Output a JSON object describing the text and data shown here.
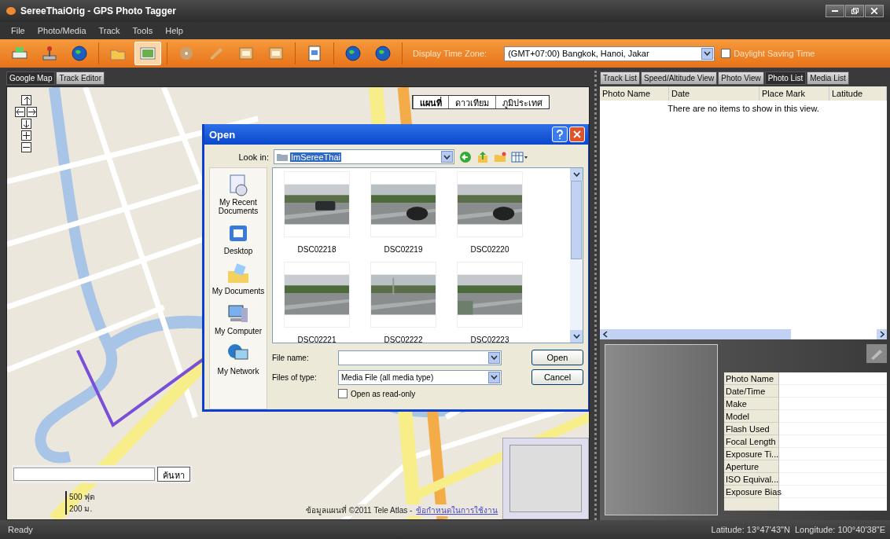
{
  "window": {
    "title": "SereeThaiOrig - GPS Photo Tagger"
  },
  "menu": [
    "File",
    "Photo/Media",
    "Track",
    "Tools",
    "Help"
  ],
  "toolbar": {
    "buttons": [
      {
        "selected": false
      },
      {
        "selected": false
      },
      {
        "selected": false
      },
      {
        "selected": false
      },
      {
        "selected": true
      },
      {
        "selected": false
      },
      {
        "selected": false
      },
      {
        "selected": false
      },
      {
        "selected": false
      },
      {
        "selected": false
      },
      {
        "selected": false
      },
      {
        "selected": false
      }
    ],
    "time_zone_label": "Display Time Zone:",
    "time_zone": "(GMT+07:00) Bangkok, Hanoi, Jakar",
    "daylight_saving": {
      "label": "Daylight Saving Time",
      "checked": false
    }
  },
  "left_tabs": [
    {
      "label": "Google Map",
      "selected": true
    },
    {
      "label": "Track Editor",
      "selected": false
    }
  ],
  "map": {
    "map_types": [
      {
        "label": "แผนที่",
        "selected": true
      },
      {
        "label": "ดาวเทียม",
        "selected": false
      },
      {
        "label": "ภูมิประเทศ",
        "selected": false
      }
    ],
    "search_button": "ค้นหา",
    "scale": [
      "500 ฟุต",
      "200 ม."
    ],
    "copyright": "ข้อมูลแผนที่ ©2011 Tele Atlas -",
    "terms_link": "ข้อกำหนดในการใช้งาน"
  },
  "dialog": {
    "title": "Open",
    "look_in_label": "Look in:",
    "look_in": "ImSereeThai",
    "places": [
      {
        "label": "My Recent Documents"
      },
      {
        "label": "Desktop"
      },
      {
        "label": "My Documents"
      },
      {
        "label": "My Computer"
      },
      {
        "label": "My Network"
      }
    ],
    "files": [
      "DSC02218",
      "DSC02219",
      "DSC02220",
      "DSC02221",
      "DSC02222",
      "DSC02223"
    ],
    "file_name_label": "File name:",
    "file_type_label": "Files of type:",
    "file_type": "Media File (all media type)",
    "read_only": {
      "label": "Open as read-only",
      "checked": false
    },
    "buttons": [
      "Open",
      "Cancel"
    ]
  },
  "right_tabs": [
    {
      "label": "Track List",
      "selected": false
    },
    {
      "label": "Speed/Altitude View",
      "selected": false
    },
    {
      "label": "Photo View",
      "selected": false
    },
    {
      "label": "Photo List",
      "selected": true
    },
    {
      "label": "Media List",
      "selected": false
    }
  ],
  "photo_list": {
    "columns": [
      "Photo Name",
      "Date",
      "Place Mark",
      "Latitude"
    ],
    "empty_message": "There are no items to show in this view."
  },
  "properties": [
    "Photo Name",
    "Date/Time",
    "Make",
    "Model",
    "Flash Used",
    "Focal Length",
    "Exposure Ti...",
    "Aperture",
    "ISO Equival...",
    "Exposure Bias"
  ],
  "status_bar": {
    "text": "Ready",
    "coordinates": "Latitude: 13°47'43\"N  Longitude: 100°40'38\"E"
  }
}
